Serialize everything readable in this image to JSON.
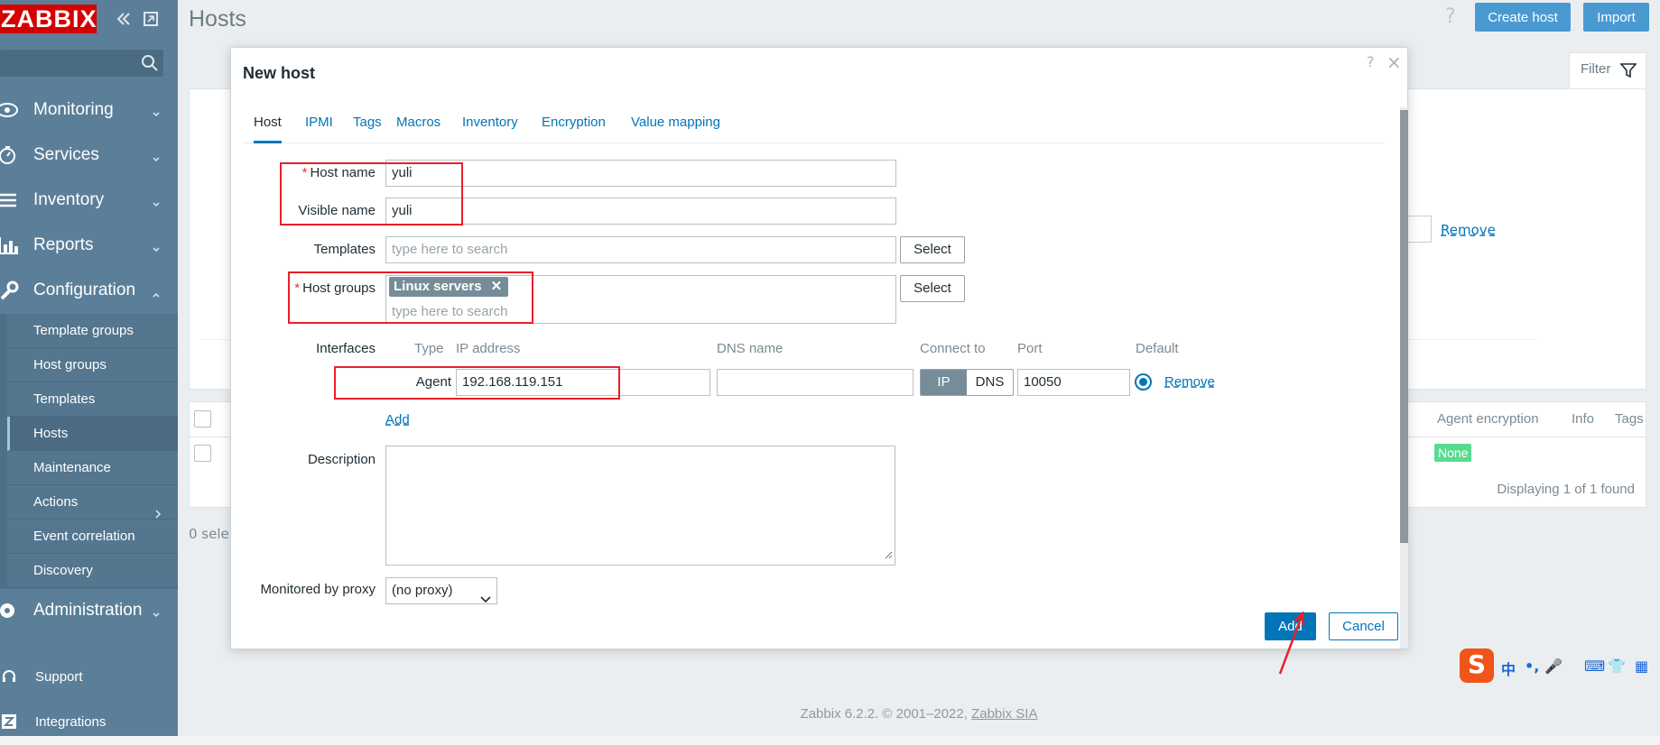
{
  "sidebar": {
    "logo": "ZABBIX",
    "menu": [
      {
        "label": "Monitoring",
        "icon": "eye-icon"
      },
      {
        "label": "Services",
        "icon": "stopwatch-icon"
      },
      {
        "label": "Inventory",
        "icon": "list-icon"
      },
      {
        "label": "Reports",
        "icon": "bar-chart-icon"
      },
      {
        "label": "Configuration",
        "icon": "wrench-icon"
      }
    ],
    "submenu": [
      "Template groups",
      "Host groups",
      "Templates",
      "Hosts",
      "Maintenance",
      "Actions",
      "Event correlation",
      "Discovery"
    ],
    "admin_label": "Administration",
    "support_label": "Support",
    "integrations_label": "Integrations"
  },
  "header": {
    "title": "Hosts",
    "help": "?",
    "create_host": "Create host",
    "import": "Import"
  },
  "filter": {
    "tab_label": "Filter",
    "remove_label": "Remove"
  },
  "list": {
    "col_agent_encryption": "Agent encryption",
    "col_info": "Info",
    "col_tags": "Tags",
    "badge_none": "None",
    "displaying": "Displaying 1 of 1 found",
    "selected": "0 selec"
  },
  "footer": {
    "text": "Zabbix 6.2.2. © 2001–2022, ",
    "link": "Zabbix SIA"
  },
  "modal": {
    "title": "New host",
    "help": "?",
    "close": "×",
    "tabs": [
      "Host",
      "IPMI",
      "Tags",
      "Macros",
      "Inventory",
      "Encryption",
      "Value mapping"
    ],
    "active_tab": "Host",
    "form": {
      "host_name_label": "Host name",
      "host_name_value": "yuli",
      "visible_name_label": "Visible name",
      "visible_name_value": "yuli",
      "templates_label": "Templates",
      "templates_placeholder": "type here to search",
      "select_label": "Select",
      "host_groups_label": "Host groups",
      "host_group_chip": "Linux servers",
      "host_groups_placeholder": "type here to search",
      "interfaces_label": "Interfaces",
      "col_type": "Type",
      "col_ip": "IP address",
      "col_dns": "DNS name",
      "col_connect": "Connect to",
      "col_port": "Port",
      "col_default": "Default",
      "agent_type": "Agent",
      "ip_value": "192.168.119.151",
      "dns_value": "",
      "connect_ip": "IP",
      "connect_dns": "DNS",
      "port_value": "10050",
      "remove_label": "Remove",
      "add_label": "Add",
      "description_label": "Description",
      "proxy_label": "Monitored by proxy",
      "proxy_value": "(no proxy)"
    },
    "add_button": "Add",
    "cancel_button": "Cancel"
  },
  "ime": {
    "logo": "S",
    "items": [
      "中",
      "•,",
      "🎤",
      "⌨",
      "👕",
      "▦"
    ]
  },
  "colors": {
    "sidebar": "#5c7f99",
    "accent": "#0275b8",
    "logo": "#d40000",
    "annotation": "#e8202a"
  }
}
